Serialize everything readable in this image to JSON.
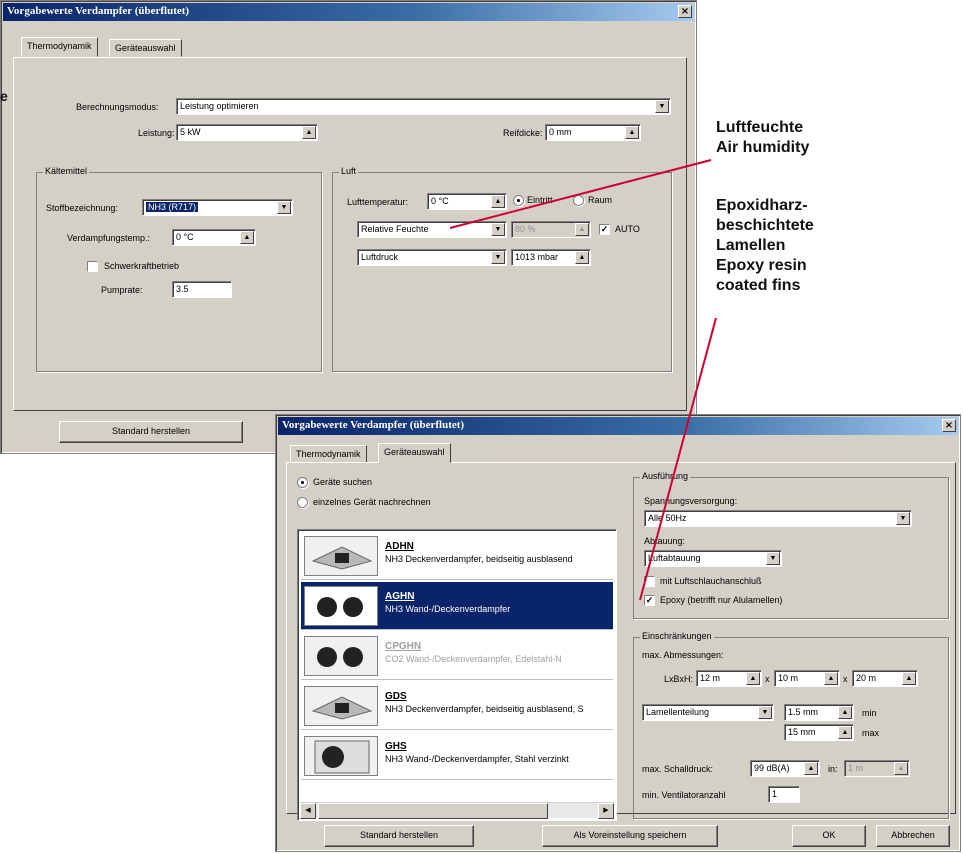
{
  "dialog1": {
    "title": "Vorgabewerte Verdampfer (überflutet)",
    "close": "×",
    "tabs": [
      "Thermodynamik",
      "Geräteauswahl"
    ],
    "berechnungsmodus_label": "Berechnungsmodus:",
    "berechnungsmodus_value": "Leistung optimieren",
    "leistung_label": "Leistung:",
    "leistung_value": "5 kW",
    "reifdicke_label": "Reifdicke:",
    "reifdicke_value": "0 mm",
    "kaeltemittel": {
      "title": "Kältemittel",
      "stoff_label": "Stoffbezeichnung:",
      "stoff_value": "NH3 (R717)",
      "verdampfungstemp_label": "Verdampfungstemp.:",
      "verdampfungstemp_value": "0 °C",
      "schwerkraft_label": "Schwerkraftbetrieb",
      "pumprate_label": "Pumprate:",
      "pumprate_value": "3.5"
    },
    "luft": {
      "title": "Luft",
      "lufttemp_label": "Lufttemperatur:",
      "lufttemp_value": "0 °C",
      "eintritt_label": "Eintritt",
      "raum_label": "Raum",
      "feuchte_select": "Relative Feuchte",
      "feuchte_value": "80 %",
      "auto_label": "AUTO",
      "auto_check": "✓",
      "druck_select": "Luftdruck",
      "druck_value": "1013 mbar"
    },
    "standard_button": "Standard herstellen"
  },
  "dialog2": {
    "title": "Vorgabewerte Verdampfer (überflutet)",
    "close": "×",
    "tabs": [
      "Thermodynamik",
      "Geräteauswahl"
    ],
    "radio_suchen": "Geräte suchen",
    "radio_nachrechnen": "einzelnes Gerät nachrechnen",
    "devices": [
      {
        "name": "ADHN",
        "desc": "NH3 Deckenverdampfer, beidseitig ausblasend"
      },
      {
        "name": "AGHN",
        "desc": "NH3 Wand-/Deckenverdampfer"
      },
      {
        "name": "CPGHN",
        "desc": "CO2 Wand-/Deckenverdampfer, Edelstahl-N"
      },
      {
        "name": "GDS",
        "desc": "NH3 Deckenverdampfer, beidseitig ausblasend, S"
      },
      {
        "name": "GHS",
        "desc": "NH3 Wand-/Deckenverdampfer, Stahl verzinkt"
      }
    ],
    "ausfuehrung": {
      "title": "Ausführung",
      "spannung_label": "Spannungsversorgung:",
      "spannung_value": "Alle 50Hz",
      "abtauung_label": "Abtauung:",
      "abtauung_value": "Luftabtauung",
      "luftschlauch_label": "mit Luftschlauchanschluß",
      "epoxy_label": "Epoxy (betrifft nur Alulamellen)",
      "epoxy_check": "✓"
    },
    "einschraenkungen": {
      "title": "Einschränkungen",
      "abm_label": "max. Abmessungen:",
      "lbh_label": "LxBxH:",
      "l_value": "12 m",
      "x1": "x",
      "b_value": "10 m",
      "x2": "x",
      "h_value": "20 m",
      "lamellen_select": "Lamellenteilung",
      "lam_min_value": "1.5 mm",
      "min_label": "min",
      "lam_max_value": "15 mm",
      "max_label": "max",
      "schall_label": "max. Schalldruck:",
      "schall_value": "99 dB(A)",
      "in_label": "in:",
      "in_value": "1 m",
      "vent_label": "min. Ventilatoranzahl",
      "vent_value": "1"
    },
    "buttons": {
      "standard": "Standard herstellen",
      "voreinstellung": "Als Voreinstellung speichern",
      "ok": "OK",
      "abbrechen": "Abbrechen"
    }
  },
  "annotations": {
    "fragment": "e",
    "luftfeuchte_de": "Luftfeuchte",
    "luftfeuchte_en": "Air humidity",
    "epoxy_de_1": "Epoxidharz-",
    "epoxy_de_2": "beschichtete",
    "epoxy_de_3": "Lamellen",
    "epoxy_en_1": "Epoxy resin",
    "epoxy_en_2": "coated fins"
  },
  "colors": {
    "dialog_face": "#d4d0c8",
    "titlebar": "#0a246a",
    "selection": "#0a246a",
    "callout_line": "#cc0033"
  }
}
